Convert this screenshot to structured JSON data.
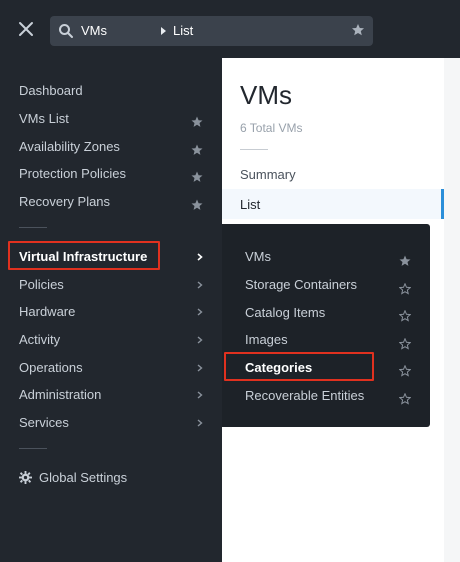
{
  "search": {
    "crumb_a": "VMs",
    "crumb_b": "List"
  },
  "nav": {
    "items": [
      {
        "label": "Dashboard"
      },
      {
        "label": "VMs List"
      },
      {
        "label": "Availability Zones"
      },
      {
        "label": "Protection Policies"
      },
      {
        "label": "Recovery Plans"
      },
      {
        "label": "Virtual Infrastructure"
      },
      {
        "label": "Policies"
      },
      {
        "label": "Hardware"
      },
      {
        "label": "Activity"
      },
      {
        "label": "Operations"
      },
      {
        "label": "Administration"
      },
      {
        "label": "Services"
      }
    ],
    "settings_label": "Global Settings"
  },
  "main": {
    "title": "VMs",
    "subtitle": "6 Total VMs",
    "tabs": [
      {
        "label": "Summary"
      },
      {
        "label": "List"
      }
    ]
  },
  "flyout": {
    "items": [
      {
        "label": "VMs"
      },
      {
        "label": "Storage Containers"
      },
      {
        "label": "Catalog Items"
      },
      {
        "label": "Images"
      },
      {
        "label": "Categories"
      },
      {
        "label": "Recoverable Entities"
      }
    ]
  },
  "colors": {
    "nav_bg": "#22272e",
    "flyout_bg": "#1d2228",
    "highlight_border": "#e0311f",
    "active_tab_accent": "#2a8ed9"
  }
}
